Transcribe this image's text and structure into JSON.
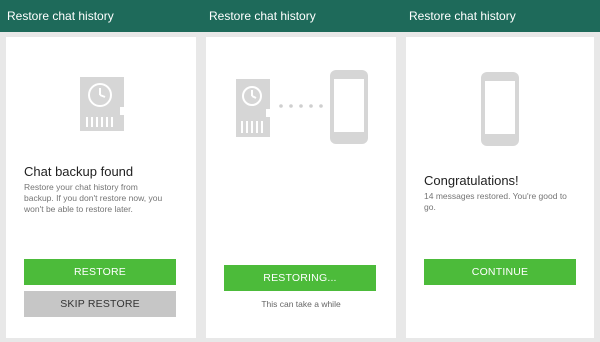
{
  "app_bar": {
    "titles": [
      "Restore chat history",
      "Restore chat history",
      "Restore chat history"
    ]
  },
  "screens": [
    {
      "heading": "Chat backup found",
      "body_lines": [
        "Restore your chat history from",
        "backup. If you don't restore now, you",
        "won't be able to restore later."
      ],
      "primary_button": "RESTORE",
      "secondary_button": "SKIP RESTORE",
      "icons": [
        "sd-card-clock-icon"
      ]
    },
    {
      "primary_button": "RESTORING...",
      "note": "This can take a while",
      "icons": [
        "sd-card-clock-icon",
        "transfer-dots-icon",
        "phone-icon"
      ]
    },
    {
      "heading": "Congratulations!",
      "body_lines": [
        "14 messages restored. You're good to",
        "go."
      ],
      "primary_button": "CONTINUE",
      "icons": [
        "phone-icon"
      ]
    }
  ],
  "colors": {
    "app_bar": "#1e6a5a",
    "accent_green": "#4cbb3a",
    "skip_grey": "#c6c6c6",
    "background": "#e8e8e8",
    "card": "#ffffff"
  }
}
